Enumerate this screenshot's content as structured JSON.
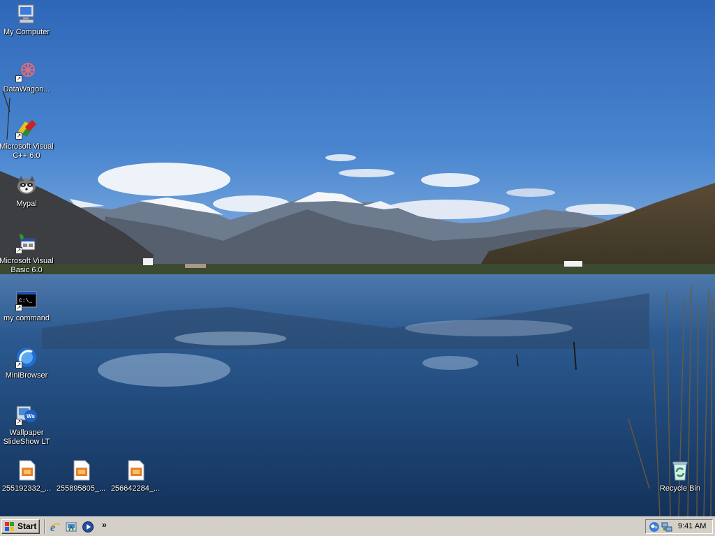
{
  "desktop": {
    "icons": [
      {
        "label": "My Computer",
        "icon": "my-computer-icon",
        "shortcut": false
      },
      {
        "label": "DataWagon...",
        "icon": "datawagon-icon",
        "shortcut": true
      },
      {
        "label": "Microsoft Visual C++ 6.0",
        "icon": "visual-cpp-icon",
        "shortcut": true
      },
      {
        "label": "Mypal",
        "icon": "mypal-raccoon-icon",
        "shortcut": false
      },
      {
        "label": "Microsoft Visual Basic 6.0",
        "icon": "visual-basic-icon",
        "shortcut": true
      },
      {
        "label": "my command",
        "icon": "command-prompt-icon",
        "shortcut": true
      },
      {
        "label": "MiniBrowser",
        "icon": "minibrowser-icon",
        "shortcut": true
      },
      {
        "label": "Wallpaper SlideShow LT",
        "icon": "wallpaper-slideshow-icon",
        "shortcut": true
      },
      {
        "label": "255192332_...",
        "icon": "image-file-icon",
        "shortcut": false
      },
      {
        "label": "255895805_...",
        "icon": "image-file-icon",
        "shortcut": false
      },
      {
        "label": "256642284_...",
        "icon": "image-file-icon",
        "shortcut": false
      },
      {
        "label": "Recycle Bin",
        "icon": "recycle-bin-icon",
        "shortcut": false
      }
    ],
    "wallpaper": "mountain-lake-reflection"
  },
  "taskbar": {
    "start_label": "Start",
    "quick_launch": [
      "internet-explorer-icon",
      "show-desktop-icon",
      "media-player-icon"
    ],
    "overflow": "»",
    "tray_icons": [
      "messenger-icon",
      "network-icon"
    ],
    "clock": "9:41 AM"
  },
  "colors": {
    "taskbar": "#d4d0c8",
    "sky": "#3f78c4",
    "water": "#1d3f6e"
  }
}
